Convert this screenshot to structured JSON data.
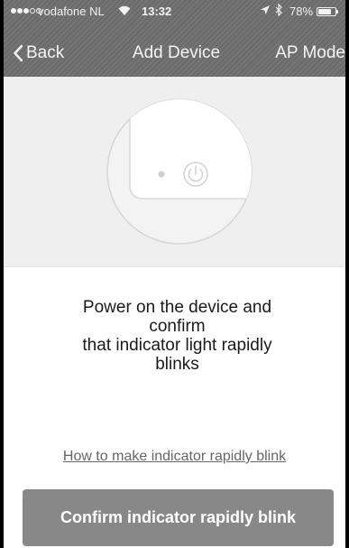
{
  "status_bar": {
    "signal_filled": 3,
    "signal_total": 5,
    "carrier": "vodafone NL",
    "time": "13:32",
    "battery_percent": "78%",
    "battery_level": 0.78,
    "icons": [
      "wifi-icon",
      "location-arrow-icon",
      "bluetooth-icon",
      "battery-icon"
    ]
  },
  "nav": {
    "back_label": "Back",
    "title": "Add Device",
    "right_action": "AP Mode",
    "back_icon": "chevron-left-icon"
  },
  "illustration": {
    "icons": [
      "device-icon",
      "indicator-light-icon",
      "power-icon"
    ]
  },
  "instruction": {
    "line1": "Power on the device and",
    "line2": "confirm",
    "line3": "that indicator light rapidly",
    "line4": "blinks"
  },
  "help_link": "How to make indicator rapidly blink",
  "confirm_button": "Confirm indicator rapidly blink",
  "colors": {
    "header_bg": "#6f6f6f",
    "illustration_bg": "#efefef",
    "button_bg": "#888888",
    "text": "#1a1a1a",
    "link": "#666666"
  }
}
